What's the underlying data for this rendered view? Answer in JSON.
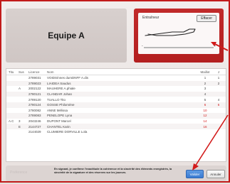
{
  "team": {
    "title": "Equipe A"
  },
  "signature": {
    "label": "Entraîneur",
    "clear_label": "Effacer",
    "slider_min": "-",
    "slider_max": "+"
  },
  "table": {
    "headers": {
      "titu": "Titu",
      "sus": "Sus",
      "licence": "Licence",
      "nom": "Nom",
      "maillot": "Maillot",
      "j": "J"
    },
    "rows": [
      {
        "titu": "",
        "sus": "",
        "licence": "2789031",
        "nom": "VOIDS/nnes dumDNFF A.dis",
        "maillot": "1",
        "j": "1",
        "red": false
      },
      {
        "titu": "",
        "sus": "",
        "licence": "2789023",
        "nom": "LIAIDEA Saudus",
        "maillot": "2",
        "j": "2",
        "red": false
      },
      {
        "titu": "",
        "sus": "A",
        "licence": "2002122",
        "nom": "MAUHERE A.phiale",
        "maillot": "3",
        "j": "",
        "red": false
      },
      {
        "titu": "",
        "sus": "",
        "licence": "2780121",
        "nom": "CLANDAR Johan",
        "maillot": "4",
        "j": "",
        "red": false
      },
      {
        "titu": "",
        "sus": "",
        "licence": "2789120",
        "nom": "TUALLO Tito",
        "maillot": "5",
        "j": "4",
        "red": false
      },
      {
        "titu": "",
        "sus": "",
        "licence": "2780124",
        "nom": "GOSSE Philomène",
        "maillot": "6",
        "j": "6",
        "red": true
      },
      {
        "titu": "",
        "sus": "",
        "licence": "2780082",
        "nom": "ANNE Mélissa",
        "maillot": "10",
        "j": "",
        "red": true
      },
      {
        "titu": "",
        "sus": "",
        "licence": "2789083",
        "nom": "PENELOPE Lyna",
        "maillot": "12",
        "j": "",
        "red": true
      },
      {
        "titu": "A.C",
        "sus": "3",
        "licence": "2043246",
        "nom": "DUPONT Marcel",
        "maillot": "14",
        "j": "",
        "red": true
      },
      {
        "titu": "",
        "sus": "E",
        "licence": "2144727",
        "nom": "CHANTEL Karin",
        "maillot": "16",
        "j": "",
        "red": true
      },
      {
        "titu": "",
        "sus": "",
        "licence": "2144029",
        "nom": "CLUMIERE DORVILLE Lola",
        "maillot": "",
        "j": "",
        "red": false
      }
    ]
  },
  "bottom": {
    "left_hint": "Preference",
    "consent_text": "En signant, je confirme l'exactitude la cohérence et la sincérité des éléments enregistrés, la sincérité de la signature et des réserves sur les joueurs.",
    "valider_label": "Valider",
    "annuler_label": "Annuler"
  },
  "colors": {
    "accent": "#c21a1a",
    "primary_button": "#3a7bd2"
  }
}
